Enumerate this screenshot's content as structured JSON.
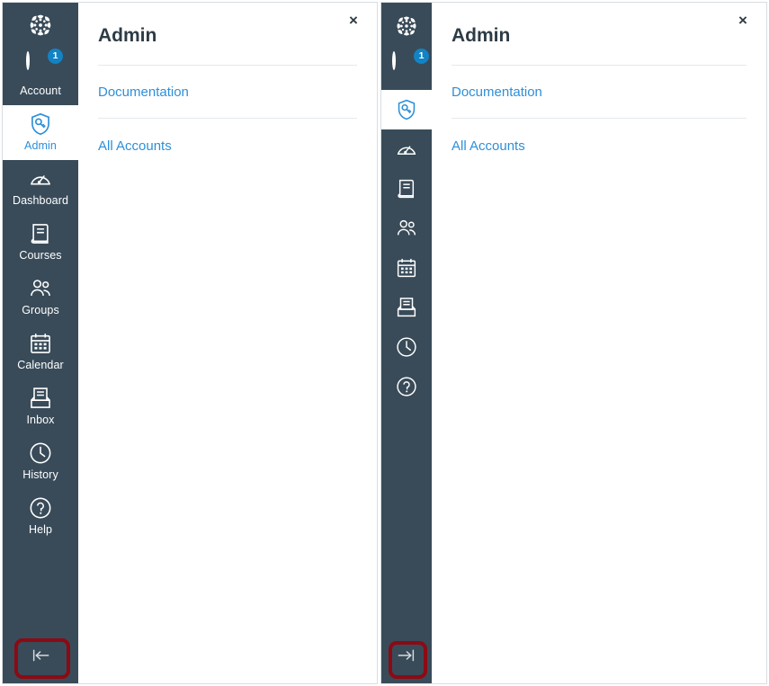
{
  "window": {
    "background_color": "#ffffff",
    "border_color": "#d9dee2",
    "accent_blue": "#2D8FD8",
    "nav_background": "#394B59",
    "annotation_color": "#8C0A13",
    "badge_color": "#1283C4"
  },
  "panels": [
    {
      "id": "expanded",
      "state": "expanded",
      "global_nav": {
        "logo": {
          "icon": "canvas-logo-icon",
          "label": "Canvas"
        },
        "account": {
          "icon": "avatar-icon",
          "label": "Account",
          "badge": "1"
        },
        "items": [
          {
            "icon": "admin-shield-key-icon",
            "label": "Admin",
            "active": true
          },
          {
            "icon": "dashboard-gauge-icon",
            "label": "Dashboard",
            "active": false
          },
          {
            "icon": "courses-book-icon",
            "label": "Courses",
            "active": false
          },
          {
            "icon": "groups-people-icon",
            "label": "Groups",
            "active": false
          },
          {
            "icon": "calendar-icon",
            "label": "Calendar",
            "active": false
          },
          {
            "icon": "inbox-tray-icon",
            "label": "Inbox",
            "active": false
          },
          {
            "icon": "history-clock-icon",
            "label": "History",
            "active": false
          },
          {
            "icon": "help-question-icon",
            "label": "Help",
            "active": false
          }
        ],
        "toggle": {
          "icon": "collapse-arrow-left-icon",
          "label": "Minimize Global Navigation",
          "highlighted": true
        }
      },
      "tray": {
        "close": {
          "icon": "close-icon",
          "label": "×"
        },
        "title": "Admin",
        "links": [
          {
            "label": "Documentation"
          },
          {
            "label": "All Accounts"
          }
        ]
      }
    },
    {
      "id": "collapsed",
      "state": "collapsed",
      "global_nav": {
        "logo": {
          "icon": "canvas-logo-icon",
          "label": "Canvas"
        },
        "account": {
          "icon": "avatar-icon",
          "label": "Account",
          "badge": "1"
        },
        "items": [
          {
            "icon": "admin-shield-key-icon",
            "label": "Admin",
            "active": true
          },
          {
            "icon": "dashboard-gauge-icon",
            "label": "Dashboard",
            "active": false
          },
          {
            "icon": "courses-book-icon",
            "label": "Courses",
            "active": false
          },
          {
            "icon": "groups-people-icon",
            "label": "Groups",
            "active": false
          },
          {
            "icon": "calendar-icon",
            "label": "Calendar",
            "active": false
          },
          {
            "icon": "inbox-tray-icon",
            "label": "Inbox",
            "active": false
          },
          {
            "icon": "history-clock-icon",
            "label": "History",
            "active": false
          },
          {
            "icon": "help-question-icon",
            "label": "Help",
            "active": false
          }
        ],
        "toggle": {
          "icon": "expand-arrow-right-icon",
          "label": "Expand Global Navigation",
          "highlighted": true
        }
      },
      "tray": {
        "close": {
          "icon": "close-icon",
          "label": "×"
        },
        "title": "Admin",
        "links": [
          {
            "label": "Documentation"
          },
          {
            "label": "All Accounts"
          }
        ]
      }
    }
  ]
}
